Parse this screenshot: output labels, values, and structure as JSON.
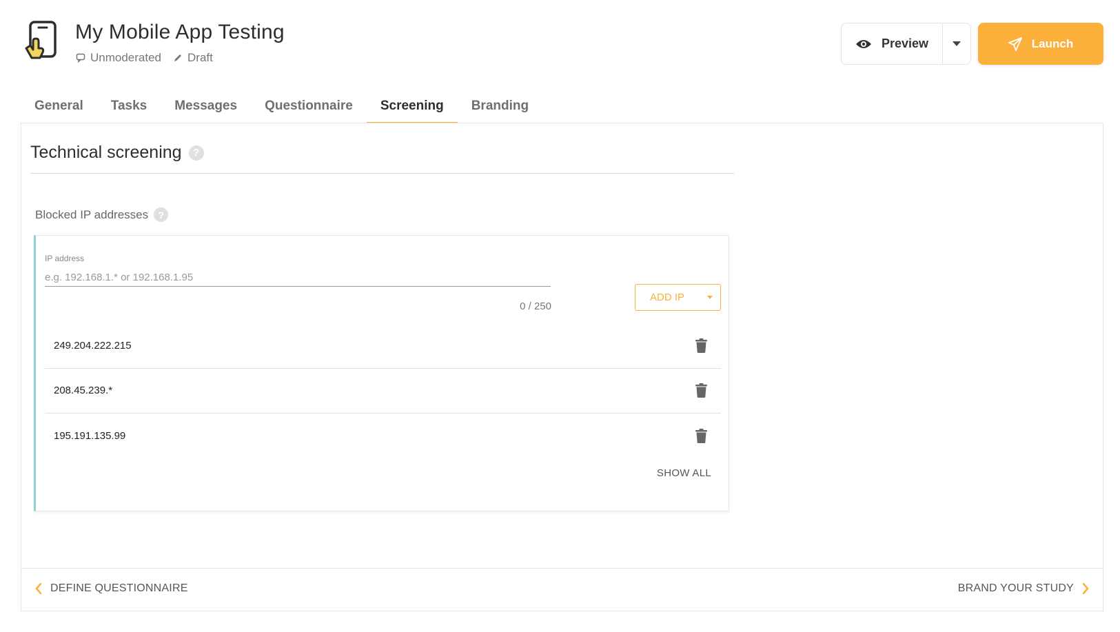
{
  "header": {
    "title": "My Mobile App Testing",
    "mode": "Unmoderated",
    "status": "Draft",
    "preview_label": "Preview",
    "launch_label": "Launch"
  },
  "tabs": [
    {
      "label": "General",
      "active": false
    },
    {
      "label": "Tasks",
      "active": false
    },
    {
      "label": "Messages",
      "active": false
    },
    {
      "label": "Questionnaire",
      "active": false
    },
    {
      "label": "Screening",
      "active": true
    },
    {
      "label": "Branding",
      "active": false
    }
  ],
  "section": {
    "title": "Technical screening",
    "help": "?"
  },
  "blocked_ips": {
    "label": "Blocked IP addresses",
    "help": "?",
    "input_label": "IP address",
    "input_placeholder": "e.g. 192.168.1.* or 192.168.1.95",
    "input_value": "",
    "char_count": "0 / 250",
    "add_label": "ADD IP",
    "items": [
      "249.204.222.215",
      "208.45.239.*",
      "195.191.135.99"
    ],
    "show_all_label": "SHOW ALL"
  },
  "footer": {
    "prev_label": "DEFINE QUESTIONNAIRE",
    "next_label": "BRAND YOUR STUDY"
  },
  "colors": {
    "accent": "#fbb03b",
    "card_border": "#8fd1d0",
    "icon_dark": "#666666"
  }
}
